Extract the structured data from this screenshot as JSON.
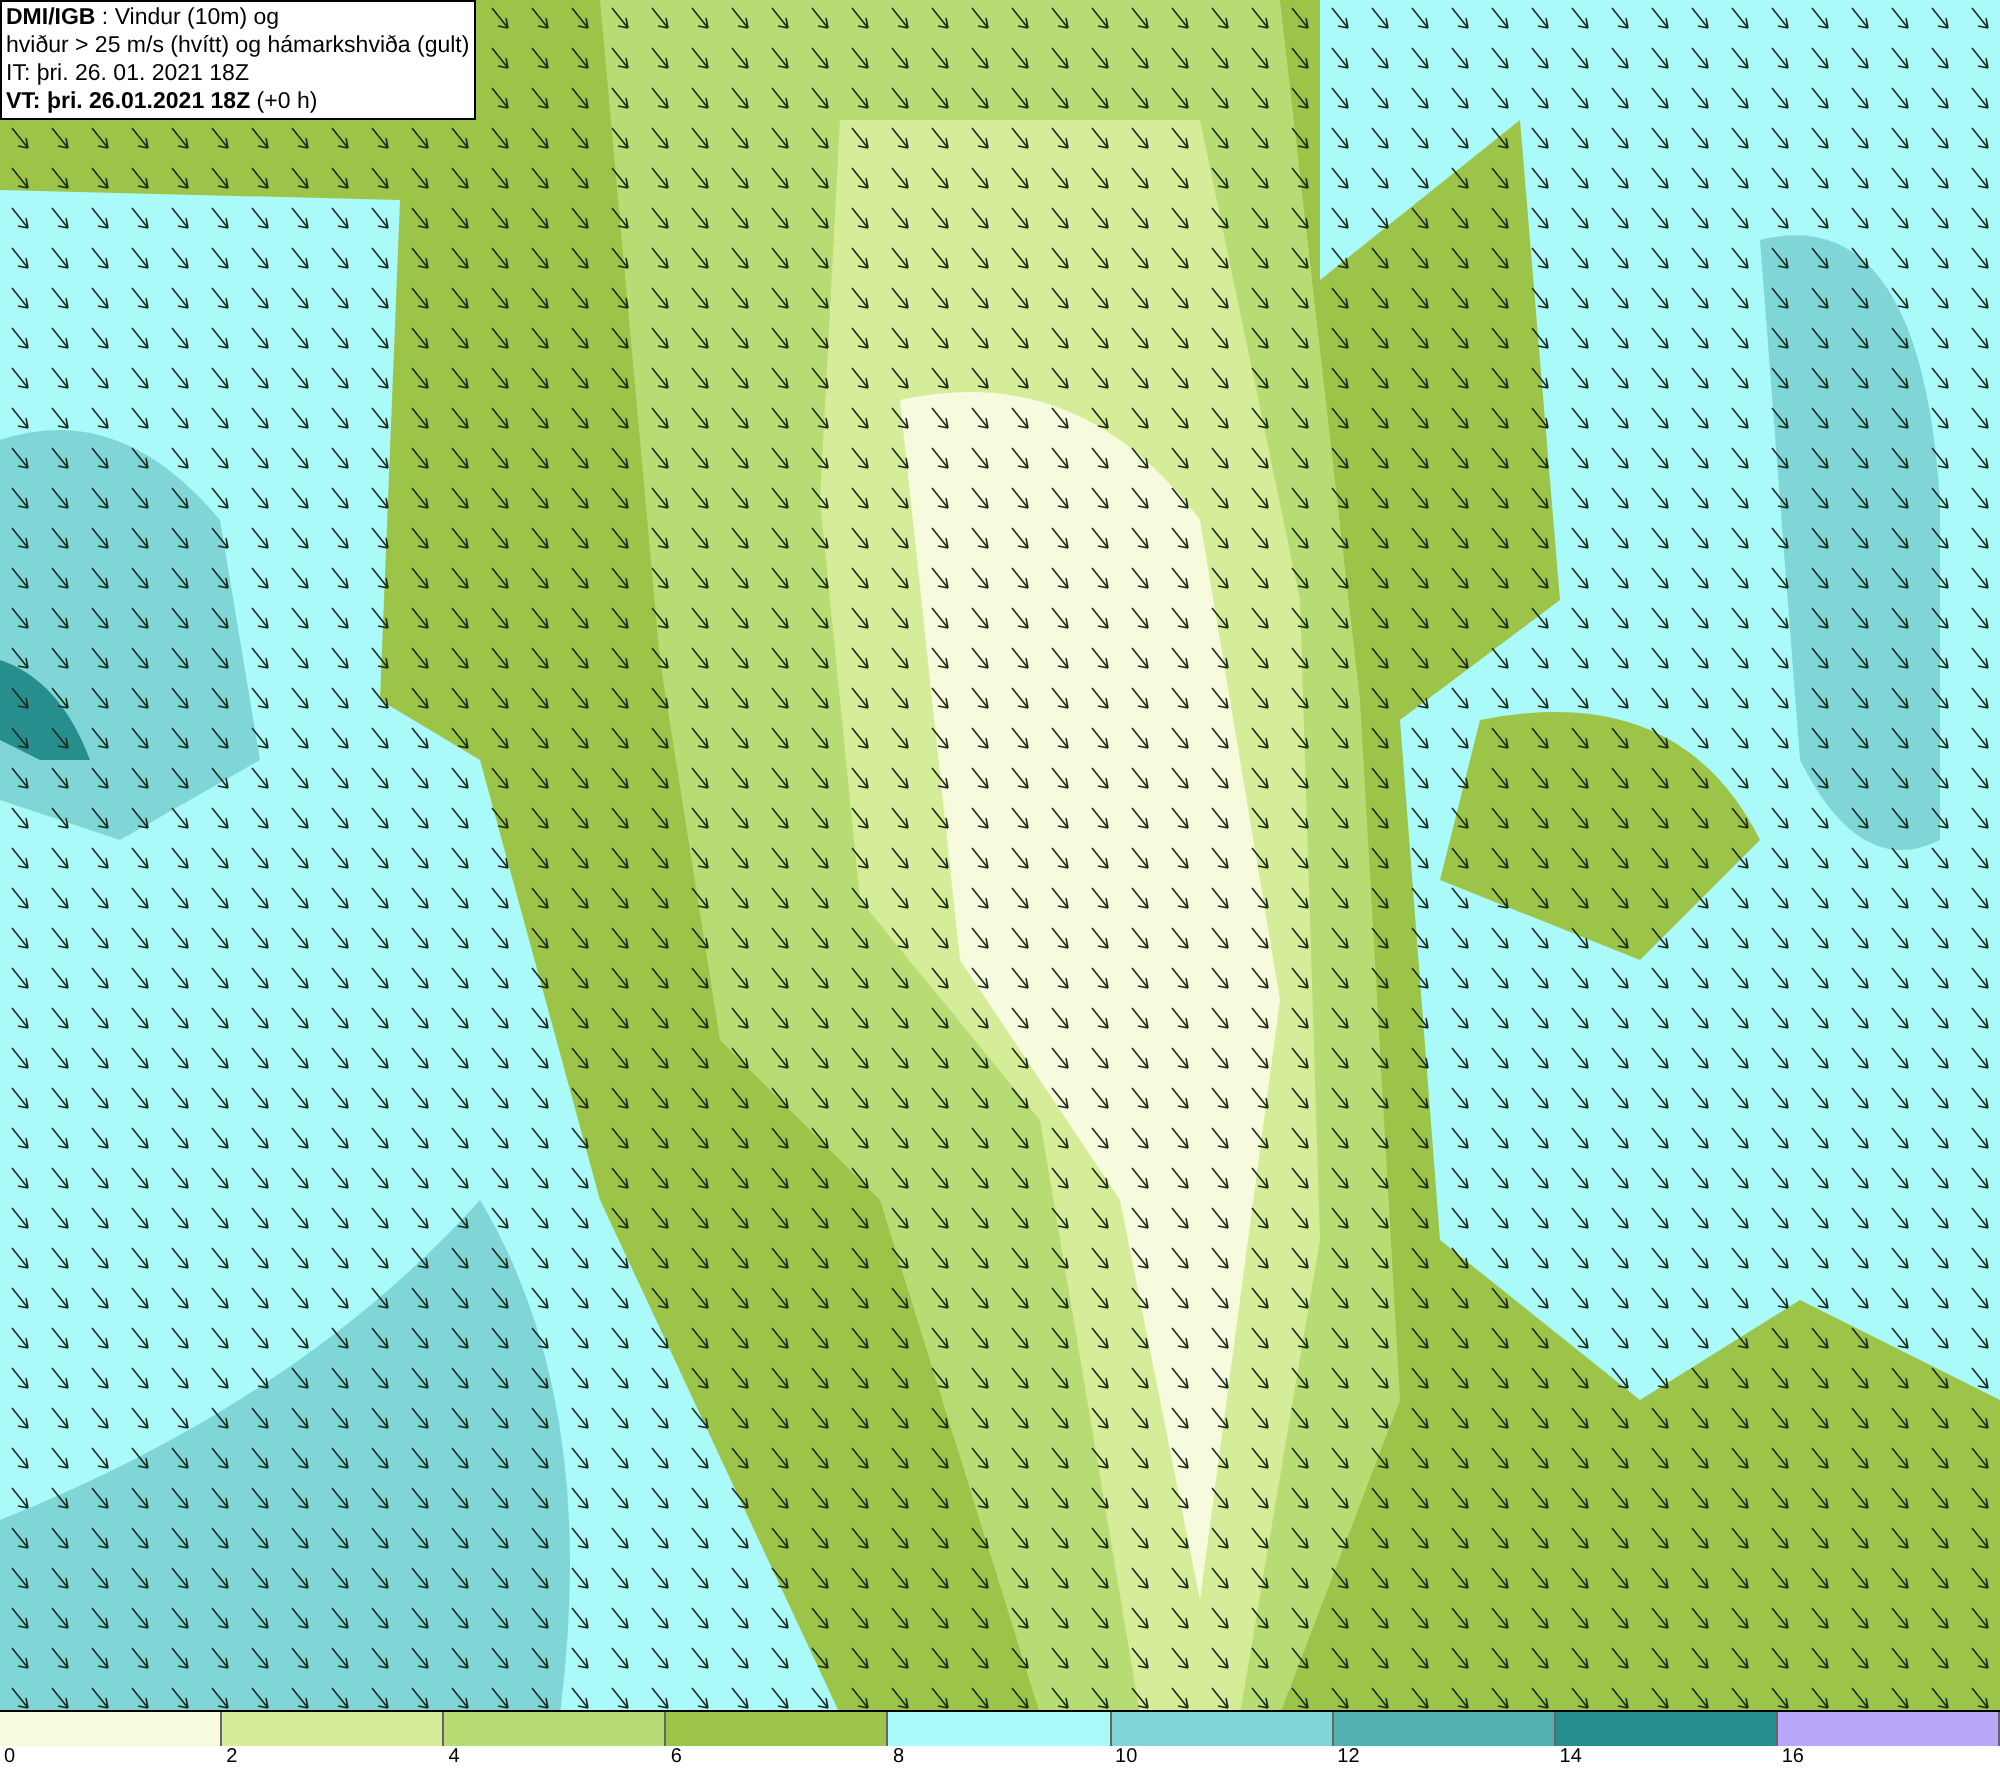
{
  "info_box": {
    "lines": [
      "**DMI/IGB** : Vindur (10m) og",
      "hviður > 25 m/s (hvítt) og hámarkshviða (gult)",
      "IT: þri. 26. 01. 2021 18Z",
      "**VT: þri. 26.01.2021 18Z** (+0 h)"
    ]
  },
  "legend": {
    "bins": [
      {
        "label": "0",
        "color": "#f6fbdd"
      },
      {
        "label": "2",
        "color": "#d5ec98"
      },
      {
        "label": "4",
        "color": "#b8dc74"
      },
      {
        "label": "6",
        "color": "#9cc448"
      },
      {
        "label": "8",
        "color": "#aafafa"
      },
      {
        "label": "10",
        "color": "#80d6d6"
      },
      {
        "label": "12",
        "color": "#52b2b2"
      },
      {
        "label": "14",
        "color": "#278e8e"
      },
      {
        "label": "16",
        "color": "#b8a6f8"
      }
    ]
  }
}
